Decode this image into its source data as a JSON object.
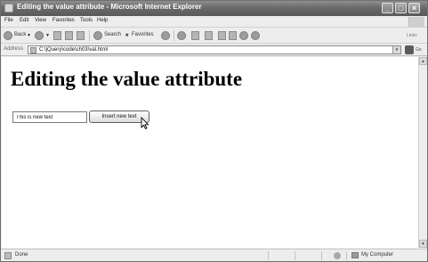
{
  "window": {
    "title": "Editing the value attribute - Microsoft Internet Explorer"
  },
  "menu": {
    "items": [
      "File",
      "Edit",
      "View",
      "Favorites",
      "Tools",
      "Help"
    ]
  },
  "toolbar": {
    "back_label": "Back",
    "search_label": "Search",
    "favorites_label": "Favorites",
    "links_label": "Links"
  },
  "address": {
    "label": "Address",
    "url": "C:\\jQuery\\code\\ch03\\val.html",
    "go_label": "Go"
  },
  "page": {
    "heading": "Editing the value attribute",
    "input_value": "This is new text",
    "button_label": "Insert new text"
  },
  "status": {
    "text": "Done",
    "zone": "My Computer"
  },
  "icons": {
    "app": "ie-icon",
    "back": "back-arrow-icon",
    "forward": "forward-arrow-icon",
    "stop": "stop-icon",
    "refresh": "refresh-icon",
    "home": "home-icon",
    "search": "search-icon",
    "favorites": "star-icon",
    "media": "media-icon",
    "history": "history-icon",
    "mail": "mail-icon",
    "print": "print-icon",
    "edit": "edit-icon",
    "discuss": "discuss-icon",
    "messenger": "messenger-icon",
    "go": "go-arrow-icon",
    "cursor": "mouse-pointer-icon",
    "computer": "computer-icon"
  }
}
